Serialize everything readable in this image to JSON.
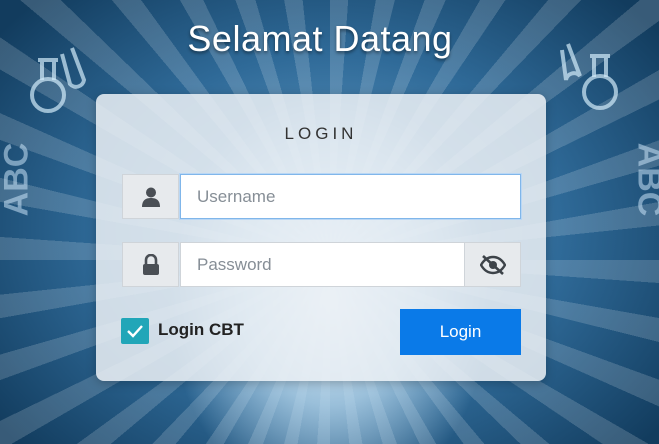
{
  "page": {
    "title": "Selamat Datang"
  },
  "login_card": {
    "heading": "LOGIN",
    "username": {
      "placeholder": "Username",
      "value": ""
    },
    "password": {
      "placeholder": "Password",
      "value": ""
    },
    "remember": {
      "label": "Login CBT",
      "checked": true
    },
    "submit_label": "Login"
  },
  "background_text": {
    "left": "ABC",
    "right": "ABC"
  },
  "icons": {
    "username": "user-icon",
    "password": "lock-icon",
    "toggle": "eye-slash-icon",
    "checkbox": "check-icon"
  },
  "colors": {
    "accent": "#0a7ae8",
    "checkbox": "#21a6b8"
  }
}
